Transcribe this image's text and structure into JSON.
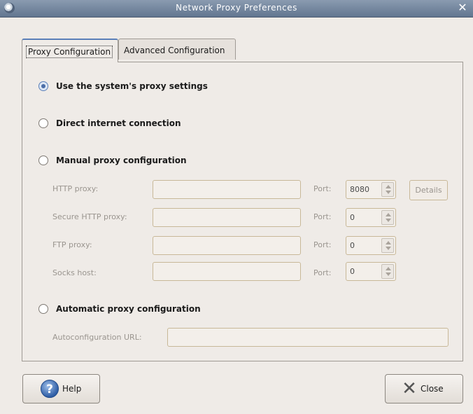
{
  "window": {
    "title": "Network Proxy Preferences",
    "close_glyph": "✕"
  },
  "tabs": [
    {
      "label": "Proxy Configuration",
      "active": true
    },
    {
      "label": "Advanced Configuration",
      "active": false
    }
  ],
  "options": {
    "system": {
      "label": "Use the system's proxy settings",
      "selected": true
    },
    "direct": {
      "label": "Direct internet connection",
      "selected": false
    },
    "manual": {
      "label": "Manual proxy configuration",
      "selected": false
    },
    "automatic": {
      "label": "Automatic proxy configuration",
      "selected": false
    }
  },
  "manual_fields": {
    "port_label": "Port:",
    "http": {
      "label": "HTTP proxy:",
      "value": "",
      "port": "8080"
    },
    "secure": {
      "label": "Secure HTTP proxy:",
      "value": "",
      "port": "0"
    },
    "ftp": {
      "label": "FTP proxy:",
      "value": "",
      "port": "0"
    },
    "socks": {
      "label": "Socks host:",
      "value": "",
      "port": "0"
    },
    "details_label": "Details"
  },
  "automatic_fields": {
    "url_label": "Autoconfiguration URL:",
    "url_value": ""
  },
  "buttons": {
    "help": "Help",
    "close": "Close"
  },
  "icons": {
    "app": "network-proxy-app-icon",
    "help": "help-icon",
    "close": "close-x-icon"
  },
  "colors": {
    "titlebar": "#627690",
    "accent": "#5a7fb8",
    "window_bg": "#efebe7"
  }
}
